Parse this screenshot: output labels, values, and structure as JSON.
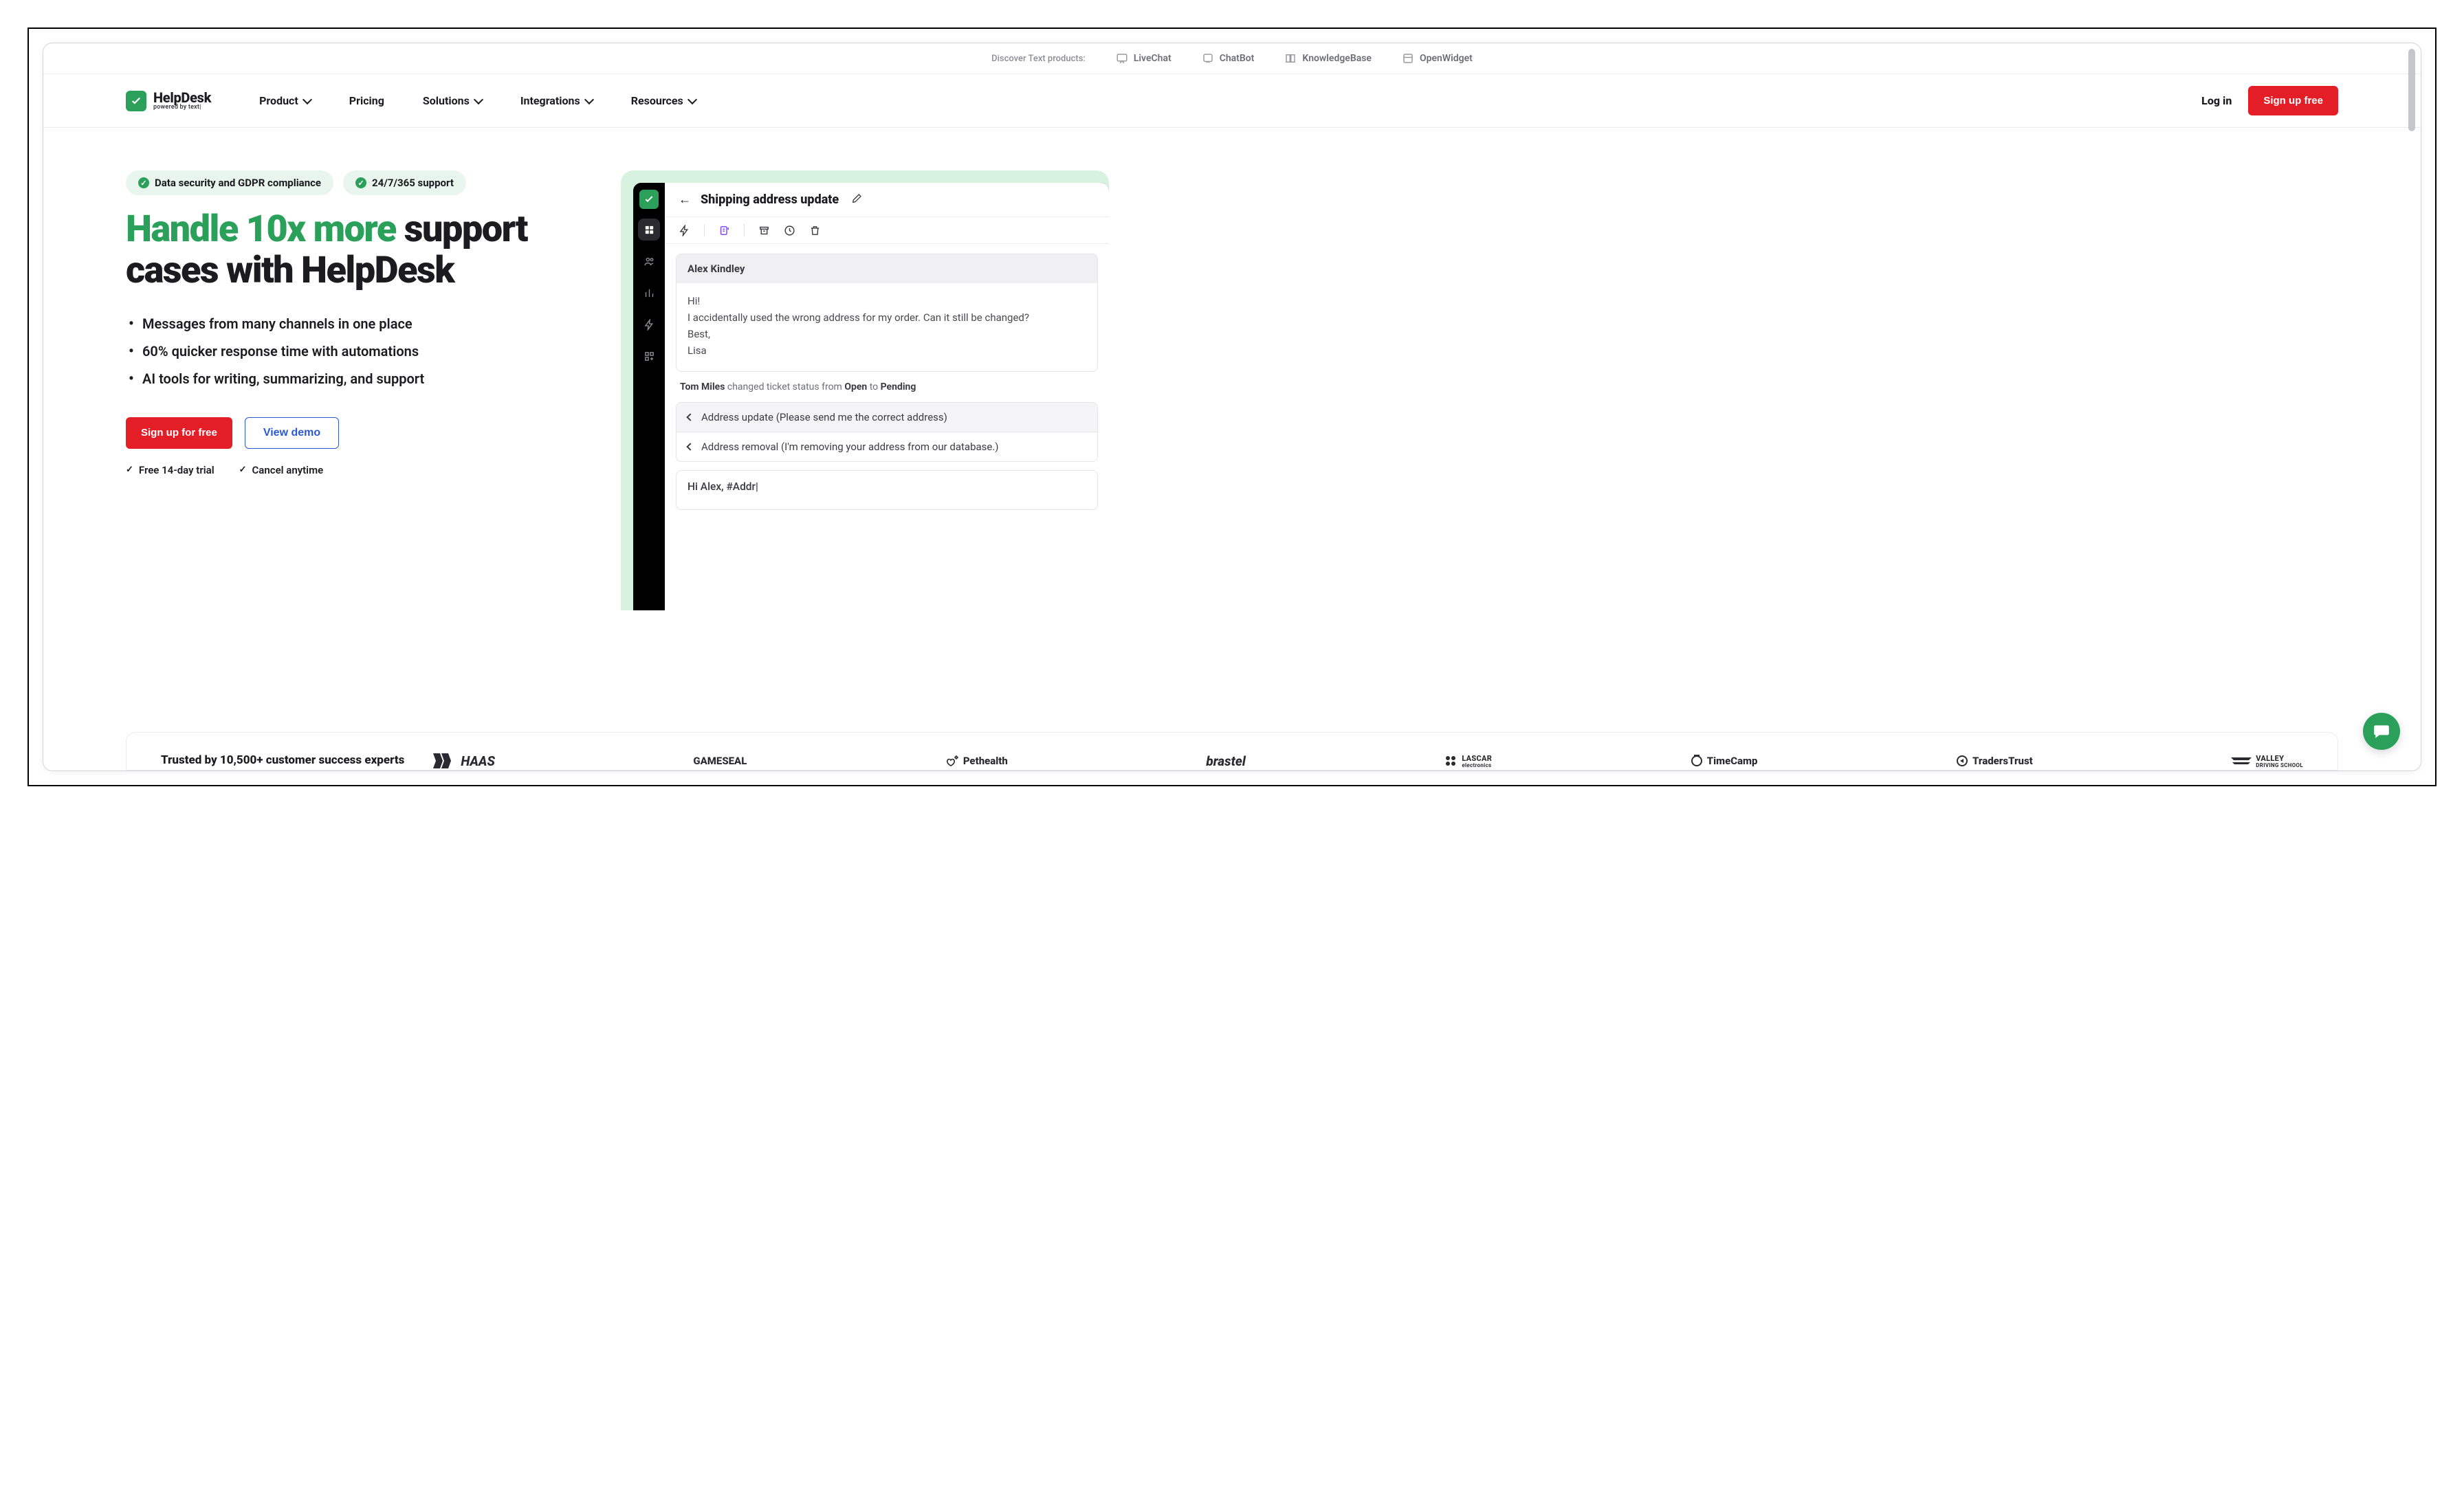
{
  "discover": {
    "label": "Discover Text products:",
    "items": [
      "LiveChat",
      "ChatBot",
      "KnowledgeBase",
      "OpenWidget"
    ]
  },
  "logo": {
    "brand": "HelpDesk",
    "powered": "powered by text|"
  },
  "nav": {
    "items": [
      "Product",
      "Pricing",
      "Solutions",
      "Integrations",
      "Resources"
    ],
    "dropdown_flags": [
      true,
      false,
      true,
      true,
      true
    ],
    "login": "Log in",
    "signup": "Sign up free"
  },
  "hero": {
    "badges": [
      "Data security and GDPR compliance",
      "24/7/365 support"
    ],
    "headline_green": "Handle 10x more",
    "headline_rest": " support cases with HelpDesk",
    "bullets": [
      "Messages from many channels in one place",
      "60% quicker response time with automations",
      "AI tools for writing, summarizing, and support"
    ],
    "cta_primary": "Sign up for free",
    "cta_secondary": "View demo",
    "disclaimers": [
      "Free 14-day trial",
      "Cancel anytime"
    ]
  },
  "app": {
    "ticket_title": "Shipping address update",
    "message_from": "Alex Kindley",
    "message_body": "Hi!\nI accidentally used the wrong address for my order. Can it still be changed?\nBest,\nLisa",
    "status_actor": "Tom Miles",
    "status_mid": " changed ticket status from ",
    "status_from": "Open",
    "status_to_word": " to ",
    "status_to": "Pending",
    "suggestions": [
      "Address update (Please send me the correct address)",
      "Address removal (I'm removing your address from our database.)"
    ],
    "compose_text": "Hi Alex, #Addr"
  },
  "trusted": {
    "text": "Trusted by 10,500+ customer success experts",
    "logos": [
      "HAAS",
      "GAMESEAL",
      "Pethealth",
      "brastel",
      "LASCAR",
      "TimeCamp",
      "TradersTrust",
      "VALLEY"
    ]
  }
}
